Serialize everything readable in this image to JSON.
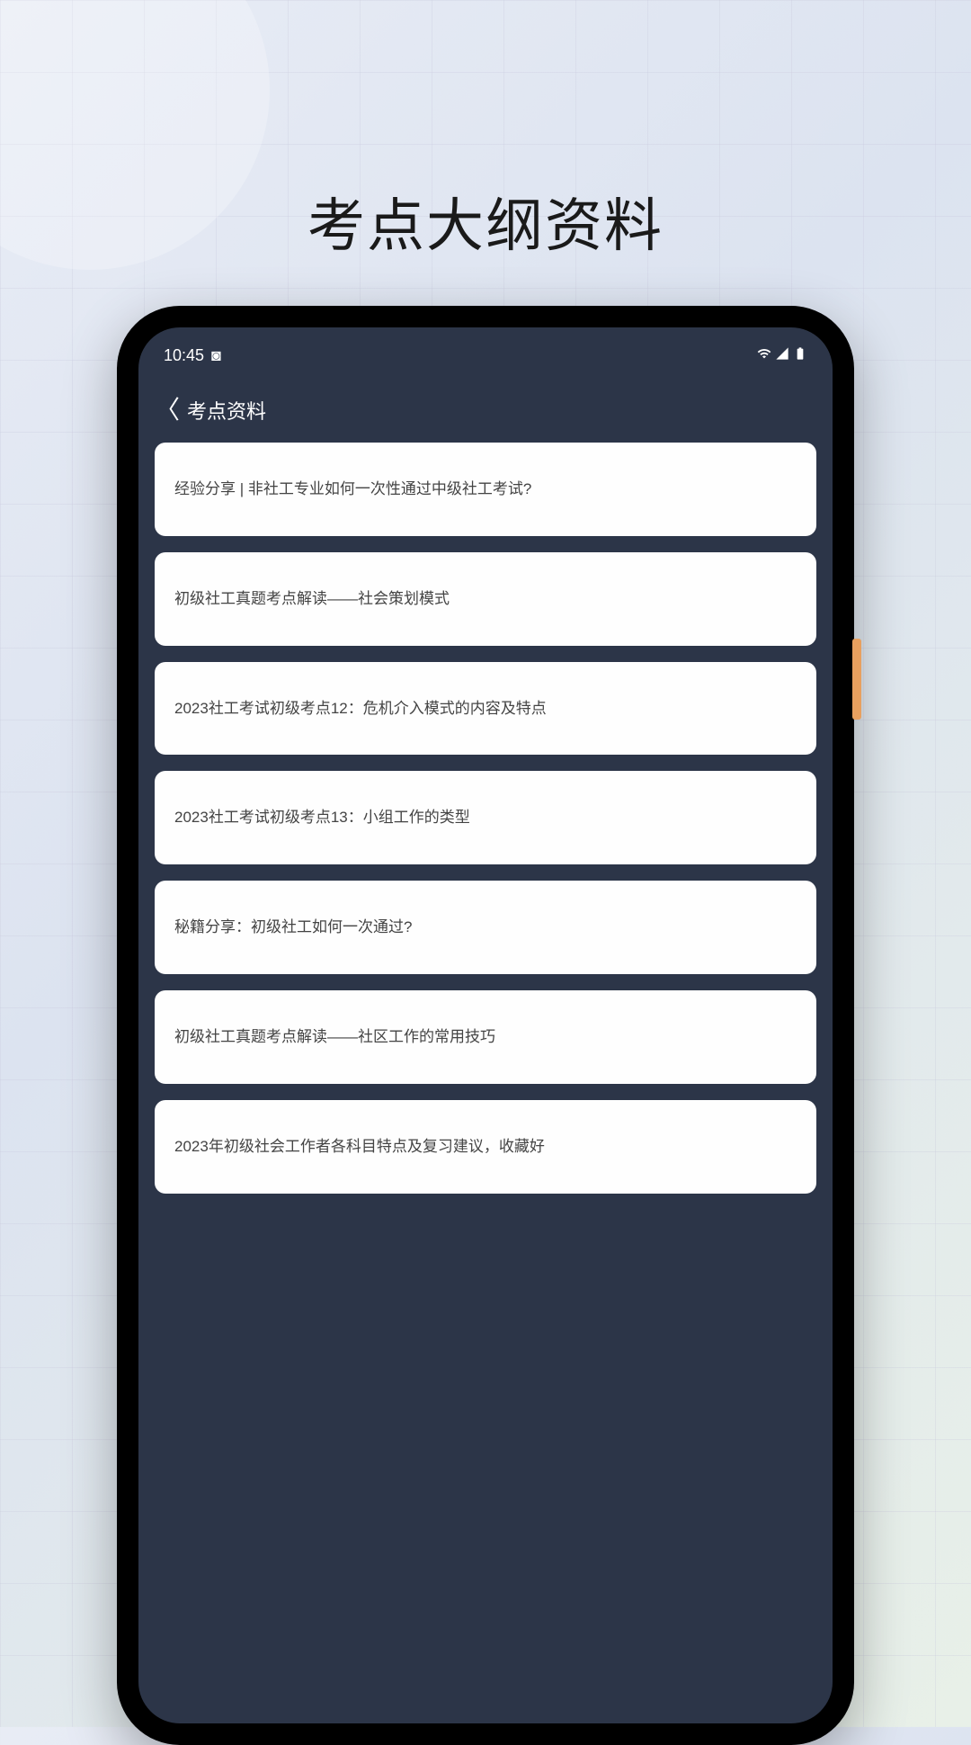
{
  "promo": {
    "title": "考点大纲资料"
  },
  "statusBar": {
    "time": "10:45",
    "indicator": "◙"
  },
  "header": {
    "backGlyph": "〈",
    "title": "考点资料"
  },
  "list": {
    "items": [
      {
        "text": "经验分享 | 非社工专业如何一次性通过中级社工考试?"
      },
      {
        "text": "初级社工真题考点解读——社会策划模式"
      },
      {
        "text": "2023社工考试初级考点12：危机介入模式的内容及特点"
      },
      {
        "text": "2023社工考试初级考点13：小组工作的类型"
      },
      {
        "text": "秘籍分享：初级社工如何一次通过?"
      },
      {
        "text": "初级社工真题考点解读——社区工作的常用技巧"
      },
      {
        "text": "2023年初级社会工作者各科目特点及复习建议，收藏好"
      }
    ]
  }
}
